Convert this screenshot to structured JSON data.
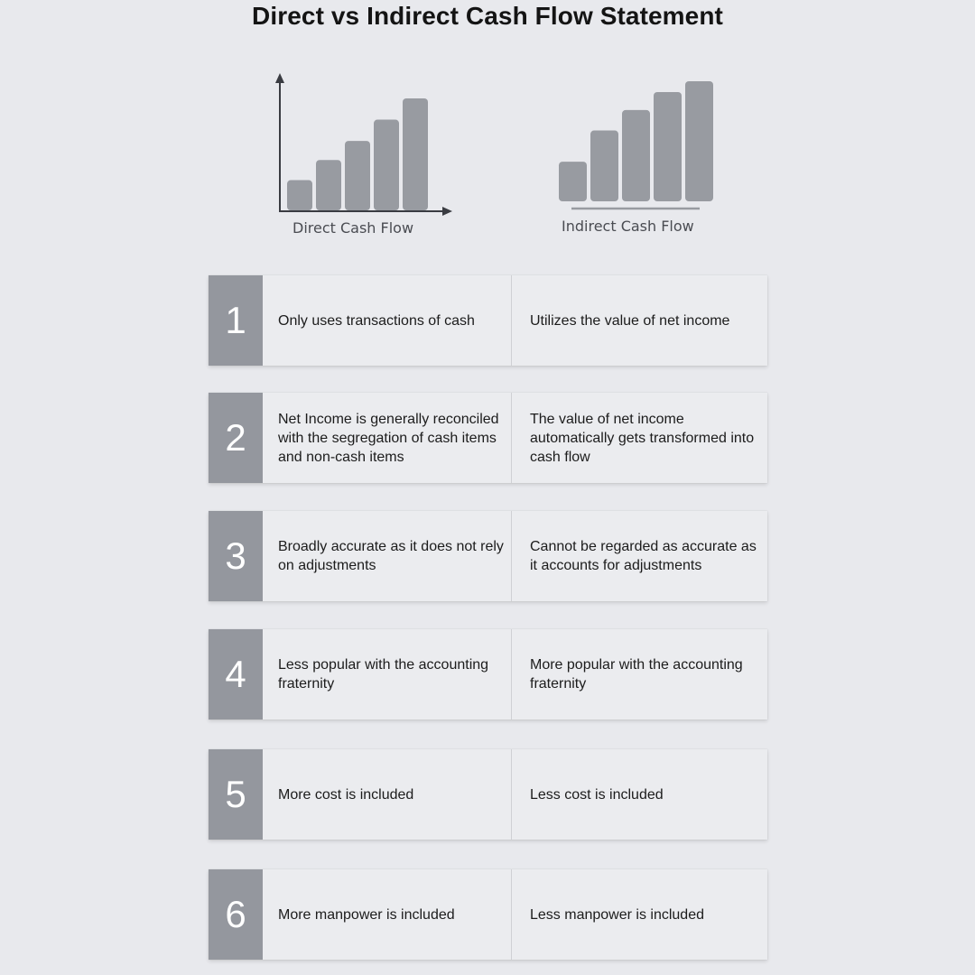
{
  "title": "Direct vs Indirect Cash Flow Statement",
  "colors": {
    "background": "#e8e9ed",
    "card": "#ebecef",
    "number_band": "#94979e",
    "bar": "#989ba1",
    "axis": "#3a3c42",
    "text": "#1c1c1c"
  },
  "charts": [
    {
      "label": "Direct Cash Flow",
      "icon": "bar-chart-with-axes-icon",
      "relative_values": [
        0.27,
        0.45,
        0.62,
        0.81,
        1.0
      ]
    },
    {
      "label": "Indirect Cash Flow",
      "icon": "bar-chart-with-baseline-icon",
      "relative_values": [
        0.33,
        0.59,
        0.76,
        0.91,
        1.0
      ]
    }
  ],
  "rows": [
    {
      "number": "1",
      "direct": "Only uses transactions of cash",
      "indirect": "Utilizes the value of net income"
    },
    {
      "number": "2",
      "direct": "Net Income is generally reconciled with the segregation of cash items and non-cash items",
      "indirect": "The value of net income automatically gets transformed into cash flow"
    },
    {
      "number": "3",
      "direct": "Broadly accurate as it does not rely on adjustments",
      "indirect": "Cannot be regarded as accurate as it accounts for adjustments"
    },
    {
      "number": "4",
      "direct": "Less popular with the accounting fraternity",
      "indirect": "More popular with the accounting fraternity"
    },
    {
      "number": "5",
      "direct": "More cost is included",
      "indirect": "Less cost is included"
    },
    {
      "number": "6",
      "direct": "More manpower is included",
      "indirect": "Less manpower is included"
    }
  ]
}
